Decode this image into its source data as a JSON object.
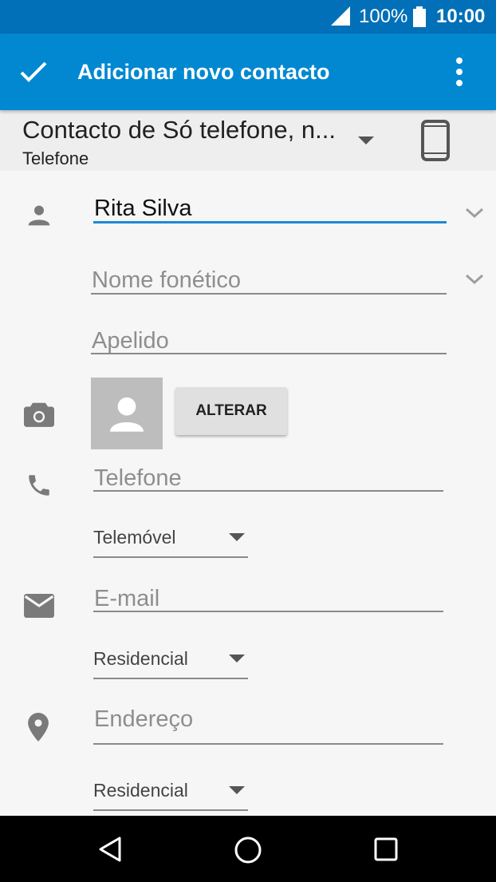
{
  "status_bar": {
    "battery": "100%",
    "time": "10:00"
  },
  "app_bar": {
    "title": "Adicionar novo contacto"
  },
  "account": {
    "name": "Contacto de Só telefone, n...",
    "type": "Telefone"
  },
  "form": {
    "name": {
      "value": "Rita Silva"
    },
    "phonetic": {
      "placeholder": "Nome fonético"
    },
    "surname": {
      "placeholder": "Apelido"
    },
    "photo": {
      "change_button": "ALTERAR"
    },
    "phone": {
      "placeholder": "Telefone",
      "type": "Telemóvel"
    },
    "email": {
      "placeholder": "E-mail",
      "type": "Residencial"
    },
    "address": {
      "placeholder": "Endereço",
      "type": "Residencial"
    }
  },
  "colors": {
    "status_bar": "#0170b8",
    "app_bar": "#0288d1",
    "accent": "#1b8ad6",
    "background": "#f6f6f6"
  },
  "icons": [
    "signal-icon",
    "battery-icon",
    "check-icon",
    "more-vert-icon",
    "dropdown-arrow-icon",
    "phone-device-icon",
    "person-icon",
    "expand-more-icon",
    "camera-icon",
    "avatar-placeholder-icon",
    "phone-icon",
    "email-icon",
    "location-icon",
    "back-nav-icon",
    "home-nav-icon",
    "recents-nav-icon"
  ]
}
